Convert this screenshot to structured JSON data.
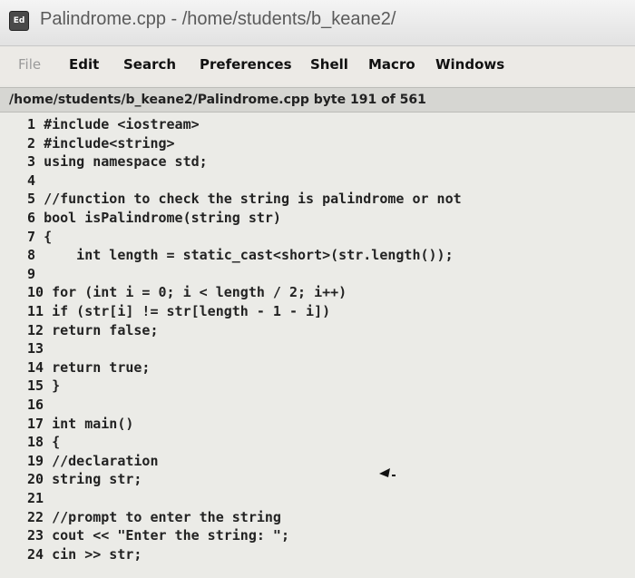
{
  "window": {
    "title": "Palindrome.cpp - /home/students/b_keane2/"
  },
  "menu": {
    "items": [
      "File",
      "Edit",
      "Search",
      "Preferences",
      "Shell",
      "Macro",
      "Windows"
    ]
  },
  "status": {
    "text": "/home/students/b_keane2/Palindrome.cpp byte 191 of 561"
  },
  "editor": {
    "lines": [
      {
        "no": "1",
        "code": "#include <iostream>"
      },
      {
        "no": "2",
        "code": "#include<string>"
      },
      {
        "no": "3",
        "code": "using namespace std;"
      },
      {
        "no": "4",
        "code": ""
      },
      {
        "no": "5",
        "code": "//function to check the string is palindrome or not"
      },
      {
        "no": "6",
        "code": "bool isPalindrome(string str)"
      },
      {
        "no": "7",
        "code": "{"
      },
      {
        "no": "8",
        "code": "    int length = static_cast<short>(str.length());"
      },
      {
        "no": "9",
        "code": ""
      },
      {
        "no": "10",
        "code": "for (int i = 0; i < length / 2; i++)"
      },
      {
        "no": "11",
        "code": "if (str[i] != str[length - 1 - i])"
      },
      {
        "no": "12",
        "code": "return false;"
      },
      {
        "no": "13",
        "code": ""
      },
      {
        "no": "14",
        "code": "return true;"
      },
      {
        "no": "15",
        "code": "}"
      },
      {
        "no": "16",
        "code": ""
      },
      {
        "no": "17",
        "code": "int main()"
      },
      {
        "no": "18",
        "code": "{"
      },
      {
        "no": "19",
        "code": "//declaration"
      },
      {
        "no": "20",
        "code": "string str;"
      },
      {
        "no": "21",
        "code": ""
      },
      {
        "no": "22",
        "code": "//prompt to enter the string"
      },
      {
        "no": "23",
        "code": "cout << \"Enter the string: \";"
      },
      {
        "no": "24",
        "code": "cin >> str;"
      }
    ]
  }
}
